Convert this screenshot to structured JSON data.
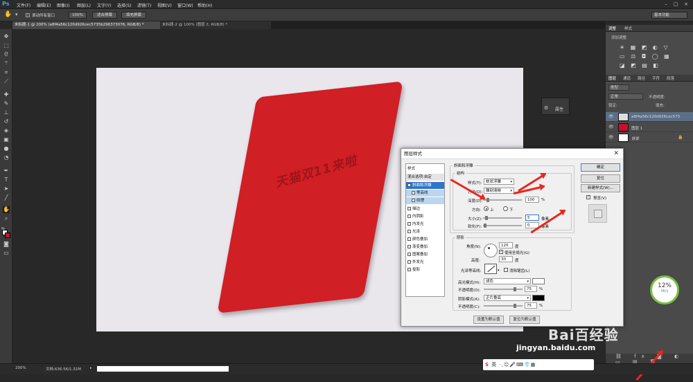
{
  "app": {
    "logo": "Ps"
  },
  "menu": [
    "文件(F)",
    "编辑(E)",
    "图像(I)",
    "图层(L)",
    "文字(Y)",
    "选择(S)",
    "滤镜(T)",
    "视图(V)",
    "窗口(W)",
    "帮助(H)"
  ],
  "workspace": "基本功能",
  "options": {
    "scroll_all": "滚动所有窗口",
    "zoom": "100%",
    "fit": "适合屏幕",
    "fill": "填充屏幕"
  },
  "tabs": [
    "未标题-1 @ 200% (a8f4a56c120d926cec5735b296373076, RGB/8) *",
    "未标题-2 @ 100% (图层 2, RGB/8) *"
  ],
  "canvas": {
    "stamp_text": "天猫双11来啦"
  },
  "properties_panel": {
    "label": "属性"
  },
  "right_panel": {
    "adjust_tabs": [
      "调整",
      "样式"
    ],
    "adjust_subtitle": "添加调整",
    "layer_tabs": [
      "图层",
      "通道",
      "路径",
      "字符",
      "段落"
    ],
    "kind": "类型",
    "blend": "正常",
    "opacity_label": "不透明度:",
    "lock_label": "锁定:",
    "fill_label": "填充:",
    "layers": [
      {
        "name": "a8f4a56c120d926cec573..."
      },
      {
        "name": "图层 1"
      },
      {
        "name": "背景"
      }
    ]
  },
  "dialog": {
    "title": "图层样式",
    "styles_header": "样式",
    "blend_options": "混合选项:自定",
    "style_items": [
      "斜面和浮雕",
      "等高线",
      "纹理",
      "描边",
      "内阴影",
      "内发光",
      "光泽",
      "颜色叠加",
      "渐变叠加",
      "图案叠加",
      "外发光",
      "投影"
    ],
    "bevel": {
      "title": "斜面和浮雕",
      "structure": "结构",
      "style_label": "样式(T):",
      "style_value": "枕状浮雕",
      "technique_label": "方法(Q):",
      "technique_value": "雕刻清晰",
      "depth_label": "深度(D):",
      "depth_value": "100",
      "depth_unit": "%",
      "direction_label": "方向:",
      "dir_up": "上",
      "dir_down": "下",
      "size_label": "大小(Z):",
      "size_value": "5",
      "size_unit": "像素",
      "soften_label": "软化(F):",
      "soften_value": "0",
      "soften_unit": "像素"
    },
    "shading": {
      "title": "阴影",
      "angle_label": "角度(N):",
      "angle_value": "120",
      "angle_unit": "度",
      "global_light": "使用全局光(G)",
      "altitude_label": "高度:",
      "altitude_value": "30",
      "altitude_unit": "度",
      "gloss_label": "光泽等高线:",
      "anti_alias": "消除锯齿(L)",
      "highlight_label": "高光模式(H):",
      "highlight_value": "滤色",
      "hl_opacity_label": "不透明度(O):",
      "hl_opacity_value": "75",
      "shadow_label": "阴影模式(A):",
      "shadow_value": "正片叠底",
      "sh_opacity_label": "不透明度(C):",
      "sh_opacity_value": "75",
      "pct": "%"
    },
    "make_default": "设置为默认值",
    "reset_default": "复位为默认值",
    "ok": "确定",
    "cancel": "复位",
    "new_style": "新建样式(W)...",
    "preview": "预览(V)"
  },
  "status": {
    "zoom": "200%",
    "doc": "文档:636.5K/1.31M"
  },
  "gauge": {
    "percent": "12%",
    "speed": "0K/s"
  },
  "watermark": {
    "brand": "Bai百经验",
    "url": "jingyan.baidu.com"
  },
  "ime": {
    "label": "英"
  },
  "colors": {
    "accent": "#3075c9",
    "arrow": "#e8251f",
    "wallet": "#d01f25"
  }
}
